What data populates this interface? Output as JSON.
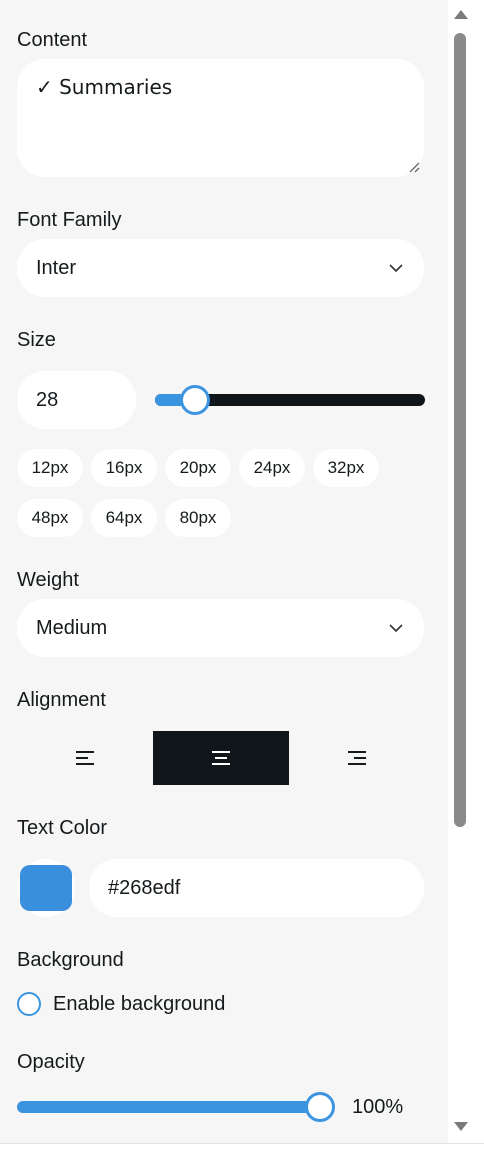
{
  "content": {
    "label": "Content",
    "value": "✓ Summaries"
  },
  "font_family": {
    "label": "Font Family",
    "selected": "Inter"
  },
  "size": {
    "label": "Size",
    "value": "28",
    "slider_value": 28,
    "presets": [
      "12px",
      "16px",
      "20px",
      "24px",
      "32px",
      "48px",
      "64px",
      "80px"
    ]
  },
  "weight": {
    "label": "Weight",
    "selected": "Medium"
  },
  "alignment": {
    "label": "Alignment",
    "options": [
      "left",
      "center",
      "right"
    ],
    "selected": "center"
  },
  "text_color": {
    "label": "Text Color",
    "value": "#268edf",
    "swatch": "#3a8fdc"
  },
  "background": {
    "label": "Background",
    "checkbox_label": "Enable background",
    "enabled": false
  },
  "opacity": {
    "label": "Opacity",
    "value_label": "100%",
    "value": 100
  },
  "colors": {
    "accent": "#3a94e0",
    "dark": "#101519"
  }
}
